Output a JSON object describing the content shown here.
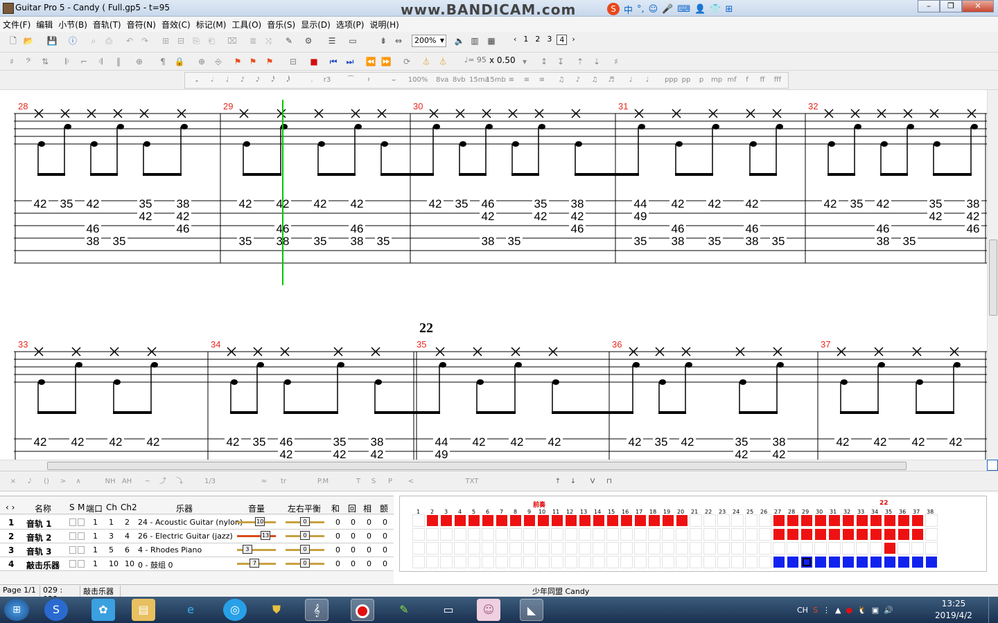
{
  "window": {
    "title": "Guitar Pro 5 - Candy ( Full.gp5 - t=95",
    "watermark": "www.BANDICAM.com",
    "ime": [
      "中",
      "°,",
      "☺",
      "🎤",
      "⌨",
      "👤",
      "👕",
      "⊞"
    ],
    "buttons": [
      "–",
      "❐",
      "✕"
    ]
  },
  "menu": [
    "文件(F)",
    "编辑",
    "小节(B)",
    "音轨(T)",
    "音符(N)",
    "音效(C)",
    "标记(M)",
    "工具(O)",
    "音乐(S)",
    "显示(D)",
    "选项(P)",
    "说明(H)"
  ],
  "toolbar": {
    "zoom": "200%",
    "pages": [
      "‹",
      "1",
      "2",
      "3",
      "4",
      "›"
    ],
    "current_page": "4",
    "tempo": "♩= 95",
    "speed": "x 0.50",
    "dynamics": [
      "ppp",
      "pp",
      "p",
      "mp",
      "mf",
      "f",
      "ff",
      "fff"
    ],
    "percent": "100%",
    "octave": [
      "8va",
      "8vb",
      "15ma",
      "15mb"
    ],
    "triplet": "r3",
    "notes": [
      "𝅝",
      "𝅗𝅥",
      "♩",
      "♪",
      "𝅘𝅥𝅯",
      "𝅘𝅥𝅰",
      "𝅘𝅥𝅱"
    ],
    "effects": [
      "×",
      "𝅘𝅥𝅮",
      "()",
      ">",
      "∧",
      "NH",
      "AH",
      "~",
      "⤴",
      "⤵",
      "1/3",
      "≈",
      "tr",
      "P.M",
      "T",
      "S",
      "P",
      "<",
      "TXT"
    ]
  },
  "score": {
    "section_label": "22",
    "system1": {
      "measures": [
        "28",
        "29",
        "30",
        "31",
        "32"
      ],
      "tab_numbers": [
        {
          "n": "42",
          "string": 1,
          "col": 0
        },
        {
          "n": "35",
          "string": 1,
          "col": 1
        },
        {
          "n": "42",
          "string": 1,
          "col": 2
        },
        {
          "n": "46",
          "string": 3,
          "col": 2
        },
        {
          "n": "38",
          "string": 4,
          "col": 2
        },
        {
          "n": "35",
          "string": 4,
          "col": 3
        },
        {
          "n": "35",
          "string": 1,
          "col": 4
        },
        {
          "n": "42",
          "string": 2,
          "col": 4
        },
        {
          "n": "38",
          "string": 1,
          "col": 5
        },
        {
          "n": "42",
          "string": 2,
          "col": 5
        },
        {
          "n": "46",
          "string": 3,
          "col": 5
        },
        {
          "n": "42",
          "string": 1,
          "col": 6
        },
        {
          "n": "35",
          "string": 4,
          "col": 6
        },
        {
          "n": "42",
          "string": 1,
          "col": 7
        },
        {
          "n": "46",
          "string": 3,
          "col": 7
        },
        {
          "n": "38",
          "string": 4,
          "col": 7
        },
        {
          "n": "42",
          "string": 1,
          "col": 8
        },
        {
          "n": "35",
          "string": 4,
          "col": 8
        },
        {
          "n": "42",
          "string": 1,
          "col": 9
        },
        {
          "n": "46",
          "string": 3,
          "col": 9
        },
        {
          "n": "38",
          "string": 4,
          "col": 9
        },
        {
          "n": "35",
          "string": 4,
          "col": 10
        },
        {
          "n": "42",
          "string": 1,
          "col": 11
        },
        {
          "n": "35",
          "string": 1,
          "col": 12
        },
        {
          "n": "46",
          "string": 1,
          "col": 13
        },
        {
          "n": "42",
          "string": 2,
          "col": 13
        },
        {
          "n": "38",
          "string": 4,
          "col": 13
        },
        {
          "n": "35",
          "string": 4,
          "col": 14
        },
        {
          "n": "35",
          "string": 1,
          "col": 15
        },
        {
          "n": "42",
          "string": 2,
          "col": 15
        },
        {
          "n": "38",
          "string": 1,
          "col": 16
        },
        {
          "n": "42",
          "string": 2,
          "col": 16
        },
        {
          "n": "46",
          "string": 3,
          "col": 16
        },
        {
          "n": "44",
          "string": 1,
          "col": 17
        },
        {
          "n": "49",
          "string": 2,
          "col": 17
        },
        {
          "n": "35",
          "string": 4,
          "col": 17
        },
        {
          "n": "42",
          "string": 1,
          "col": 18
        },
        {
          "n": "46",
          "string": 3,
          "col": 18
        },
        {
          "n": "38",
          "string": 4,
          "col": 18
        },
        {
          "n": "42",
          "string": 1,
          "col": 19
        },
        {
          "n": "35",
          "string": 4,
          "col": 19
        },
        {
          "n": "42",
          "string": 1,
          "col": 20
        },
        {
          "n": "46",
          "string": 3,
          "col": 20
        },
        {
          "n": "38",
          "string": 4,
          "col": 20
        },
        {
          "n": "35",
          "string": 4,
          "col": 21
        },
        {
          "n": "42",
          "string": 1,
          "col": 22
        },
        {
          "n": "35",
          "string": 1,
          "col": 23
        },
        {
          "n": "42",
          "string": 1,
          "col": 24
        },
        {
          "n": "46",
          "string": 3,
          "col": 24
        },
        {
          "n": "38",
          "string": 4,
          "col": 24
        },
        {
          "n": "35",
          "string": 4,
          "col": 25
        },
        {
          "n": "35",
          "string": 1,
          "col": 26
        },
        {
          "n": "42",
          "string": 2,
          "col": 26
        },
        {
          "n": "38",
          "string": 1,
          "col": 27
        },
        {
          "n": "42",
          "string": 2,
          "col": 27
        },
        {
          "n": "46",
          "string": 3,
          "col": 27
        }
      ]
    },
    "system2": {
      "measures": [
        "33",
        "34",
        "35",
        "36",
        "37"
      ],
      "tab_numbers": [
        {
          "n": "42",
          "string": 1,
          "col": 0
        },
        {
          "n": "42",
          "string": 1,
          "col": 1
        },
        {
          "n": "42",
          "string": 1,
          "col": 2
        },
        {
          "n": "42",
          "string": 1,
          "col": 3
        },
        {
          "n": "42",
          "string": 1,
          "col": 4
        },
        {
          "n": "35",
          "string": 1,
          "col": 5
        },
        {
          "n": "46",
          "string": 1,
          "col": 6
        },
        {
          "n": "42",
          "string": 2,
          "col": 6
        },
        {
          "n": "35",
          "string": 1,
          "col": 7
        },
        {
          "n": "42",
          "string": 2,
          "col": 7
        },
        {
          "n": "38",
          "string": 1,
          "col": 8
        },
        {
          "n": "42",
          "string": 2,
          "col": 8
        },
        {
          "n": "44",
          "string": 1,
          "col": 9
        },
        {
          "n": "49",
          "string": 2,
          "col": 9
        },
        {
          "n": "42",
          "string": 1,
          "col": 10
        },
        {
          "n": "42",
          "string": 1,
          "col": 11
        },
        {
          "n": "42",
          "string": 1,
          "col": 12
        },
        {
          "n": "42",
          "string": 1,
          "col": 13
        },
        {
          "n": "35",
          "string": 1,
          "col": 14
        },
        {
          "n": "42",
          "string": 1,
          "col": 15
        },
        {
          "n": "35",
          "string": 1,
          "col": 16
        },
        {
          "n": "42",
          "string": 2,
          "col": 16
        },
        {
          "n": "38",
          "string": 1,
          "col": 17
        },
        {
          "n": "42",
          "string": 2,
          "col": 17
        },
        {
          "n": "42",
          "string": 1,
          "col": 18
        },
        {
          "n": "42",
          "string": 1,
          "col": 19
        },
        {
          "n": "42",
          "string": 1,
          "col": 20
        },
        {
          "n": "42",
          "string": 1,
          "col": 21
        }
      ]
    }
  },
  "tracks": {
    "headers": [
      "名称",
      "S",
      "M",
      "端口",
      "Ch",
      "Ch2",
      "乐器",
      "音量",
      "左右平衡",
      "和",
      "回",
      "相",
      "颤"
    ],
    "rows": [
      {
        "no": "1",
        "name": "音轨 1",
        "port": "1",
        "ch": "1",
        "ch2": "2",
        "instrument": "24 - Acoustic Guitar (nylon)",
        "volume": "10",
        "pan": "0",
        "chorus": "0",
        "reverb": "0",
        "phaser": "0",
        "tremolo": "0"
      },
      {
        "no": "2",
        "name": "音轨 2",
        "port": "1",
        "ch": "3",
        "ch2": "4",
        "instrument": "26 - Electric Guitar (jazz)",
        "volume": "13",
        "pan": "0",
        "chorus": "0",
        "reverb": "0",
        "phaser": "0",
        "tremolo": "0"
      },
      {
        "no": "3",
        "name": "音轨 3",
        "port": "1",
        "ch": "5",
        "ch2": "6",
        "instrument": "4 - Rhodes Piano",
        "volume": "3",
        "pan": "0",
        "chorus": "0",
        "reverb": "0",
        "phaser": "0",
        "tremolo": "0"
      },
      {
        "no": "4",
        "name": "敲击乐器",
        "port": "1",
        "ch": "10",
        "ch2": "10",
        "instrument": "0 - 鼓组 0",
        "volume": "7",
        "pan": "0",
        "chorus": "0",
        "reverb": "0",
        "phaser": "0",
        "tremolo": "0"
      }
    ],
    "grid_numbers": [
      "1",
      "2",
      "3",
      "4",
      "5",
      "6",
      "7",
      "8",
      "9",
      "10",
      "11",
      "12",
      "13",
      "14",
      "15",
      "16",
      "17",
      "18",
      "19",
      "20",
      "21",
      "22",
      "23",
      "24",
      "25",
      "26",
      "27",
      "28",
      "29",
      "30",
      "31",
      "32",
      "33",
      "34",
      "35",
      "36",
      "37",
      "38"
    ],
    "markers": [
      {
        "label": "前奏",
        "at": "10"
      },
      {
        "label": "22",
        "at": "35"
      }
    ]
  },
  "status": {
    "page": "Page 1/1",
    "position": "029 : 038",
    "track": "敲击乐器",
    "song": "少年同盟 Candy"
  },
  "taskbar": {
    "tray_lang": "CH",
    "time": "13:25",
    "date": "2019/4/2"
  },
  "colors": {
    "measure_number": "#e8281e",
    "playhead": "#00c800",
    "grid_red": "#ee1111",
    "grid_blue": "#1122ee"
  }
}
